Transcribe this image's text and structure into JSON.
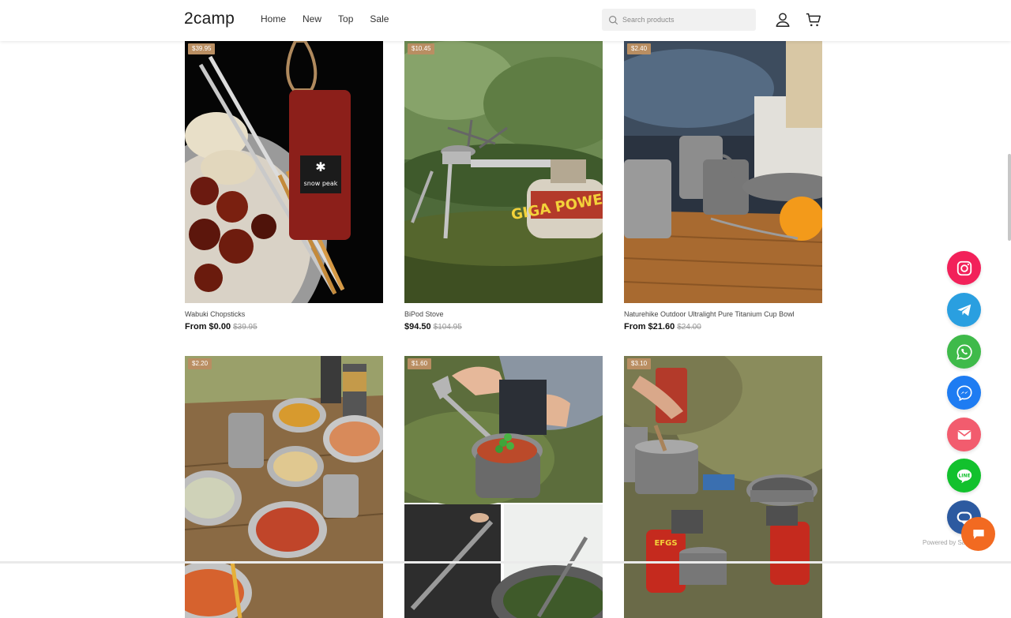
{
  "header": {
    "logo": "2camp",
    "nav": [
      "Home",
      "New",
      "Top",
      "Sale"
    ],
    "search_placeholder": "Search products"
  },
  "products": [
    {
      "badge": "$39.95",
      "name": "Wabuki Chopsticks",
      "price": "From $0.00",
      "old_price": "$39.95"
    },
    {
      "badge": "$10.45",
      "name": "BiPod Stove",
      "price": "$94.50",
      "old_price": "$104.95"
    },
    {
      "badge": "$2.40",
      "name": "Naturehike Outdoor Ultralight Pure Titanium Cup Bowl",
      "price": "From $21.60",
      "old_price": "$24.00"
    },
    {
      "badge": "$2.20"
    },
    {
      "badge": "$1.60"
    },
    {
      "badge": "$3.10"
    }
  ],
  "image_text": {
    "snow_peak": "snow peak",
    "giga_power": "GIGA POWER",
    "efgs": "EFGS"
  },
  "social": [
    {
      "name": "instagram",
      "color": "#f2215a"
    },
    {
      "name": "telegram",
      "color": "#2a9fe0"
    },
    {
      "name": "whatsapp",
      "color": "#3fba4a"
    },
    {
      "name": "messenger",
      "color": "#1e7cf2"
    },
    {
      "name": "email",
      "color": "#f25c6e"
    },
    {
      "name": "line",
      "color": "#12c12d"
    },
    {
      "name": "chat",
      "color": "#2c5aa0"
    }
  ],
  "line_label": "LINE",
  "powered_by": "Powered by SaleSmartly"
}
